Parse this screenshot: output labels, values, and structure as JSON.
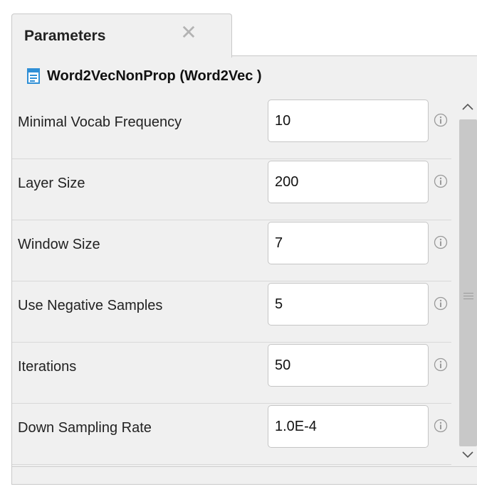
{
  "tab": {
    "title": "Parameters",
    "close_glyph": "✕"
  },
  "operator": {
    "title": "Word2VecNonProp (Word2Vec )",
    "icon": "operator-document-icon",
    "icon_color": "#2f8fd6"
  },
  "parameters": [
    {
      "label": "Minimal Vocab Frequency",
      "value": "10"
    },
    {
      "label": "Layer Size",
      "value": "200"
    },
    {
      "label": "Window Size",
      "value": "7"
    },
    {
      "label": "Use Negative Samples",
      "value": "5"
    },
    {
      "label": "Iterations",
      "value": "50"
    },
    {
      "label": "Down Sampling Rate",
      "value": "1.0E-4"
    }
  ],
  "icons": {
    "info": "info-icon",
    "scroll_up": "chevron-up-icon",
    "scroll_down": "chevron-down-icon"
  }
}
